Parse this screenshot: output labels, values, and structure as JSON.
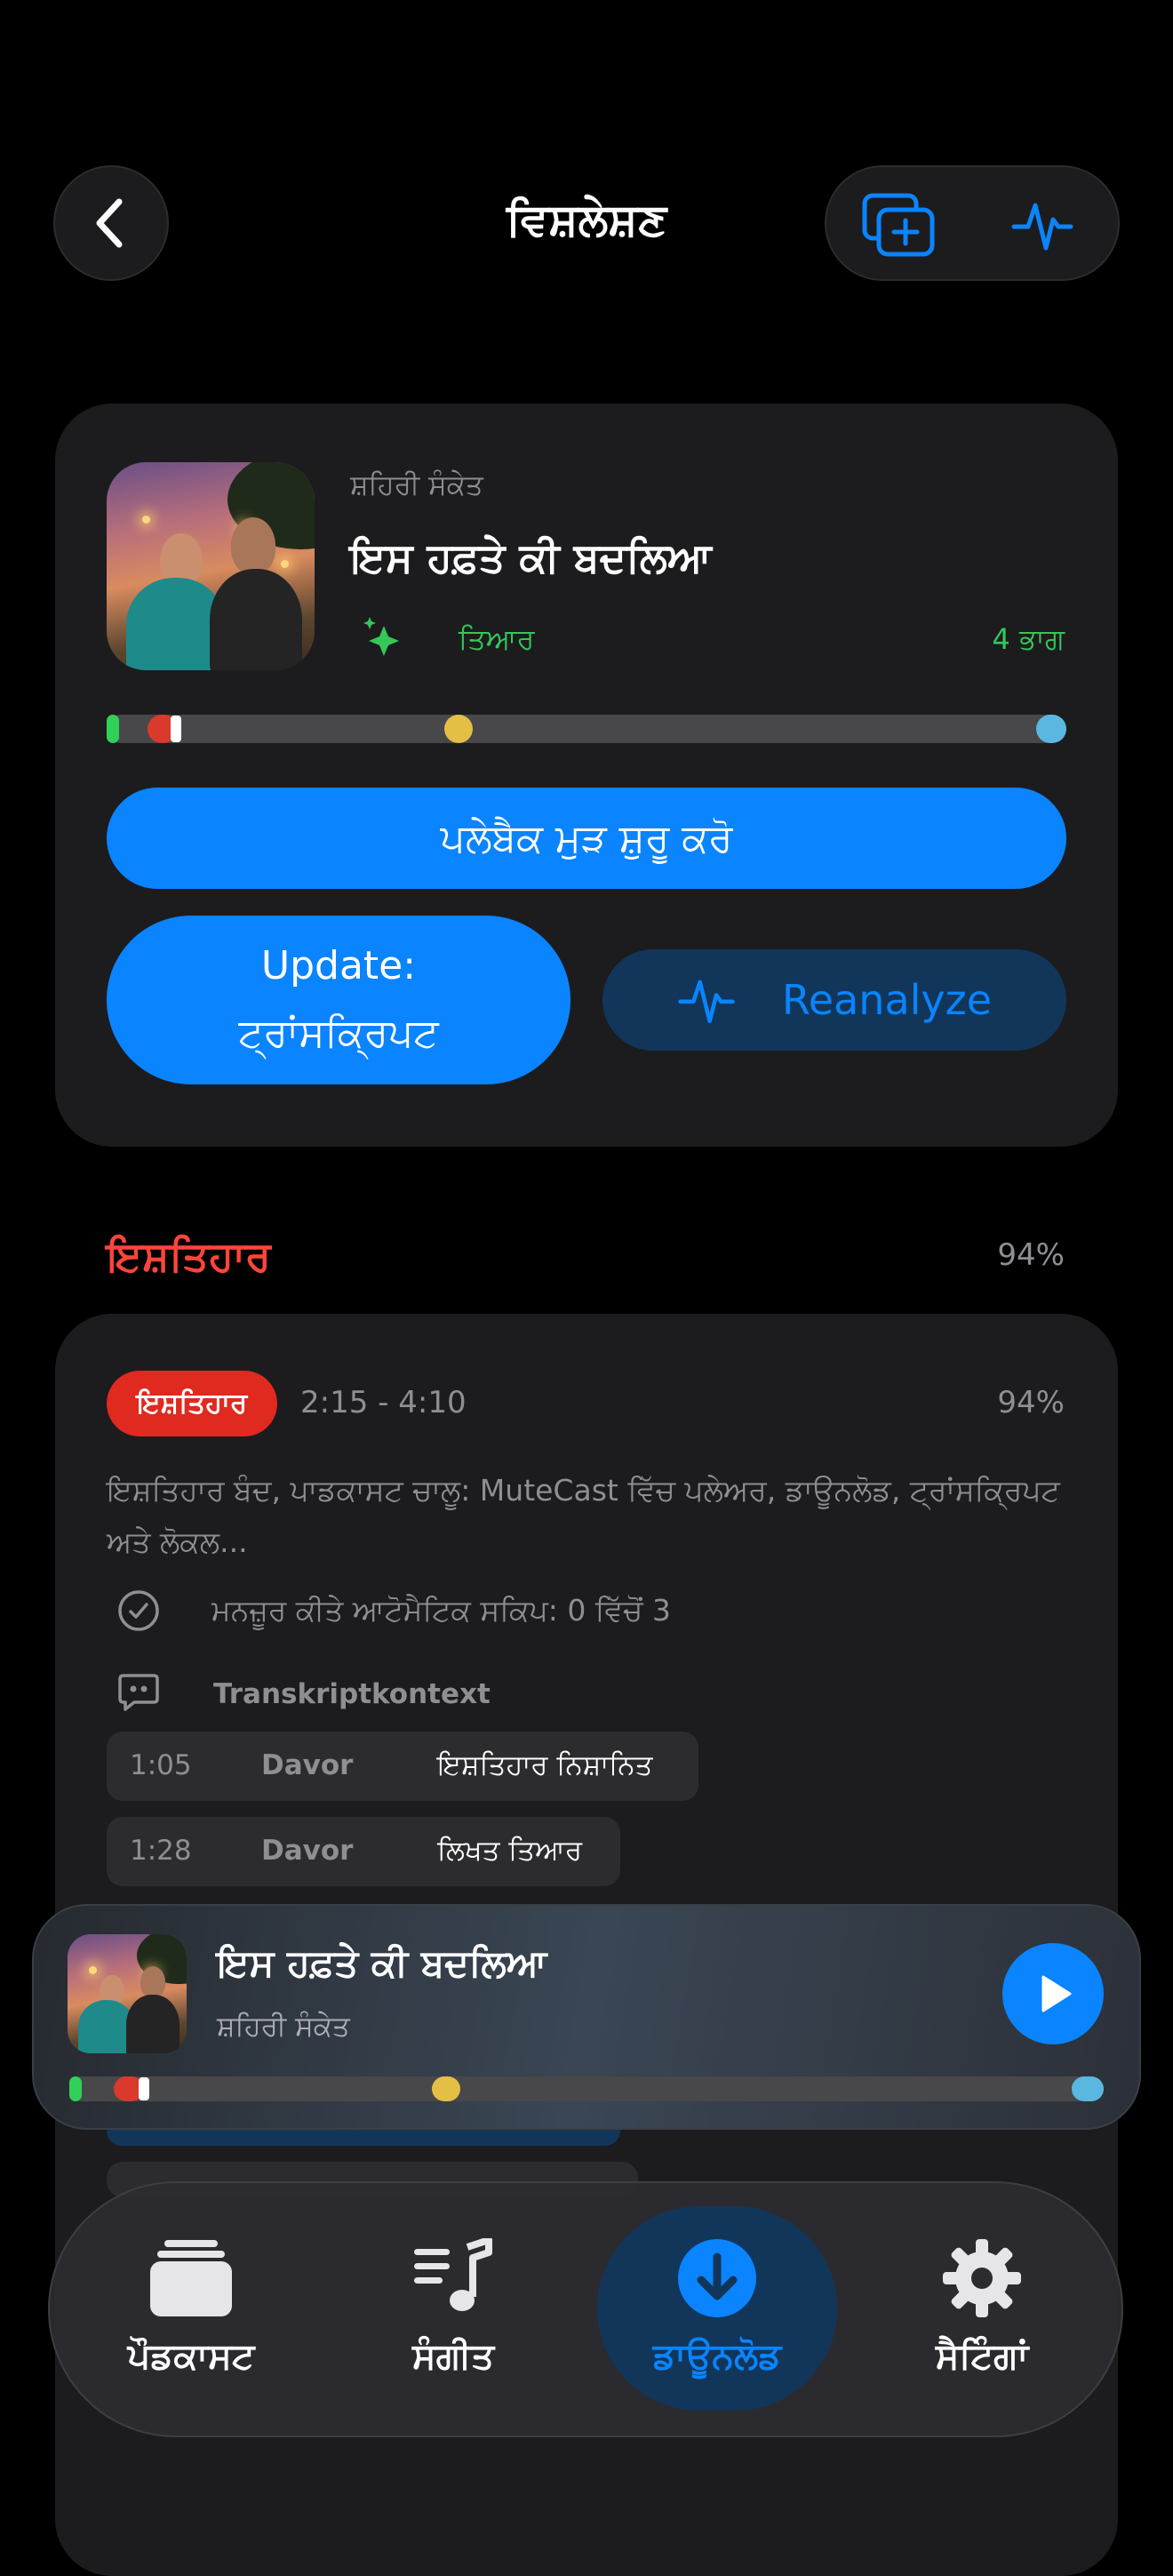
{
  "header": {
    "title": "ਵਿਸ਼ਲੇਸ਼ਣ",
    "back_icon": "chevron-left-icon",
    "actions": [
      "add-to-queue-icon",
      "waveform-icon"
    ]
  },
  "episode": {
    "show": "ਸ਼ਹਿਰੀ ਸੰਕੇਤ",
    "title": "ਇਸ ਹਫ਼ਤੇ ਕੀ ਬਦਲਿਆ",
    "status": "ਤਿਆਰ",
    "parts": "4 ਭਾਗ",
    "resume_label": "ਪਲੇਬੈਕ ਮੁੜ ਸ਼ੁਰੂ ਕਰੋ",
    "update_line1": "Update:",
    "update_line2": "ਟ੍ਰਾਂਸਕ੍ਰਿਪਟ",
    "reanalyze_label": "Reanalyze"
  },
  "timeline": {
    "colors": {
      "start": "#30d158",
      "ad": "#d93a2b",
      "mid": "#e3bf45",
      "end": "#5ab8e0",
      "track": "#48484a",
      "playhead": "#ffffff"
    },
    "playhead_fraction": 0.072
  },
  "ads": {
    "section_title": "ਇਸ਼ਤਿਹਾਰ",
    "section_confidence": "94%",
    "segment": {
      "badge": "ਇਸ਼ਤਿਹਾਰ",
      "time_range": "2:15 - 4:10",
      "confidence": "94%",
      "description": "ਇਸ਼ਤਿਹਾਰ ਬੰਦ, ਪਾਡਕਾਸਟ ਚਾਲੂ: MuteCast ਵਿੱਚ ਪਲੇਅਰ, ਡਾਊਨਲੋਡ, ਟ੍ਰਾਂਸਕ੍ਰਿਪਟ ਅਤੇ ਲੋਕਲ...",
      "approved_skips": "ਮਨਜ਼ੂਰ ਕੀਤੇ ਆਟੋਮੈਟਿਕ ਸਕਿਪ: 0 ਵਿੱਚੋਂ 3",
      "context_label": "Transkriptkontext",
      "transcript": [
        {
          "time": "1:05",
          "speaker": "Davor",
          "text": "ਇਸ਼ਤਿਹਾਰ ਨਿਸ਼ਾਨਿਤ"
        },
        {
          "time": "1:28",
          "speaker": "Davor",
          "text": "ਲਿਖਤ ਤਿਆਰ"
        }
      ]
    }
  },
  "mini_player": {
    "title": "ਇਸ ਹਫ਼ਤੇ ਕੀ ਬਦਲਿਆ",
    "show": "ਸ਼ਹਿਰੀ ਸੰਕੇਤ",
    "play_icon": "play-icon"
  },
  "tabs": [
    {
      "label": "ਪੌਡਕਾਸਟ",
      "icon": "stack-icon",
      "active": false
    },
    {
      "label": "ਸੰਗੀਤ",
      "icon": "music-list-icon",
      "active": false
    },
    {
      "label": "ਡਾਊਨਲੋਡ",
      "icon": "download-icon",
      "active": true
    },
    {
      "label": "ਸੈਟਿੰਗਾਂ",
      "icon": "gear-icon",
      "active": false
    }
  ],
  "accent": "#0a84ff"
}
